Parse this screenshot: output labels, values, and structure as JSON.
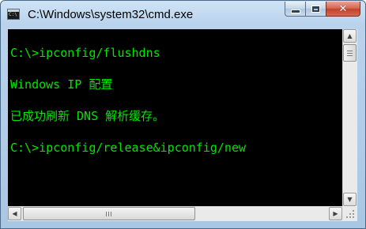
{
  "window": {
    "title": "C:\\Windows\\system32\\cmd.exe",
    "icon": "cmd-app-icon",
    "icon_prompt": "C:\\"
  },
  "caption_buttons": {
    "minimize_icon": "minimize-icon",
    "maximize_icon": "maximize-icon",
    "close_icon": "close-icon",
    "close_glyph": "✕"
  },
  "console": {
    "text_color": "#00e600",
    "background": "#000000",
    "lines": [
      "C:\\>ipconfig/flushdns",
      "Windows IP 配置",
      "已成功刷新 DNS 解析缓存。",
      "C:\\>ipconfig/release&ipconfig/new"
    ]
  },
  "scrollbars": {
    "up_arrow": "▲",
    "down_arrow": "▼",
    "left_arrow": "◀",
    "right_arrow": "▶"
  }
}
